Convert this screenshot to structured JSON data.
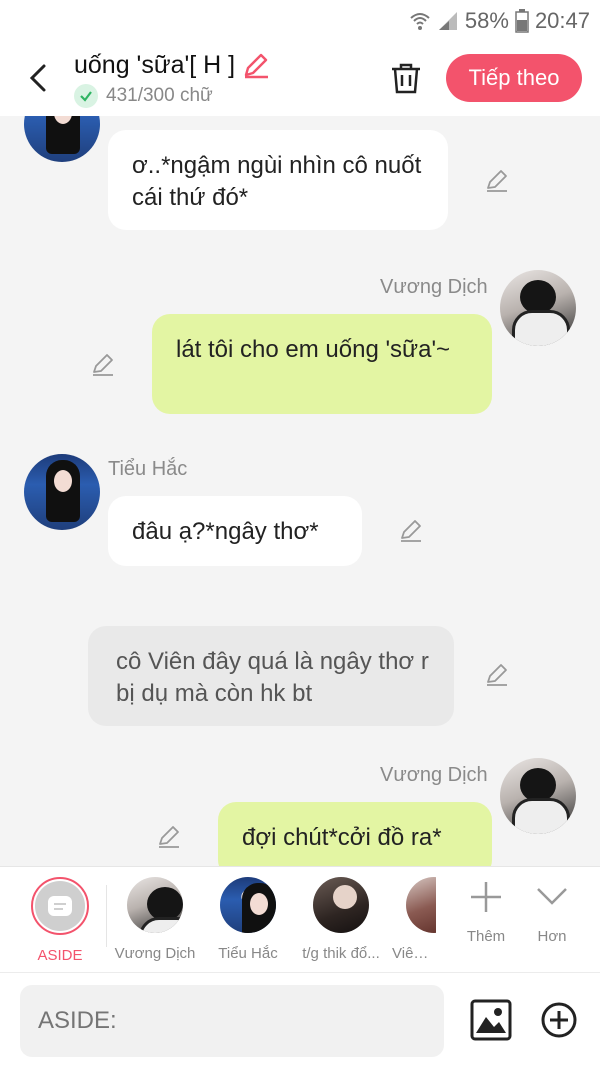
{
  "status_bar": {
    "battery": "58%",
    "time": "20:47"
  },
  "header": {
    "title": "uống 'sữa'[ H ]",
    "word_count": "431/300 chữ",
    "next_label": "Tiếp theo"
  },
  "messages": [
    {
      "type": "left",
      "speaker": "",
      "text": "ơ..*ngậm ngùi nhìn cô nuốt cái thứ đó*"
    },
    {
      "type": "right",
      "speaker": "Vương Dịch",
      "text": "lát tôi cho em uống 'sữa'~"
    },
    {
      "type": "left",
      "speaker": "Tiểu Hắc",
      "text": "đâu ạ?*ngây thơ*"
    },
    {
      "type": "aside",
      "speaker": "",
      "text": "cô Viên đây quá là ngây thơ r bị dụ mà còn hk bt"
    },
    {
      "type": "right",
      "speaker": "Vương Dịch",
      "text": "đợi chút*cởi đồ ra*"
    }
  ],
  "characters": [
    {
      "label": "ASIDE"
    },
    {
      "label": "Vương Dịch"
    },
    {
      "label": "Tiểu Hắc"
    },
    {
      "label": "t/g thik đổ..."
    },
    {
      "label": "Viên N"
    }
  ],
  "tools": {
    "add_label": "Thêm",
    "more_label": "Hơn"
  },
  "input": {
    "placeholder": "ASIDE:"
  },
  "colors": {
    "accent": "#f3536c",
    "bubble_self": "#e3f5a3",
    "bubble_other": "#ffffff",
    "bubble_aside": "#e9e9e9"
  }
}
